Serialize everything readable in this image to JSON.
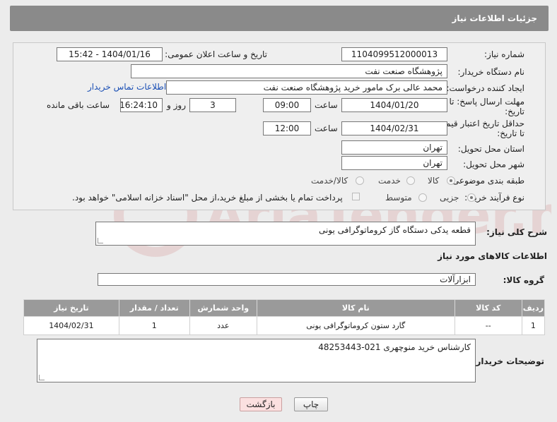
{
  "header": {
    "title": "جزئیات اطلاعات نیاز"
  },
  "form": {
    "need_number_label": "شماره نیاز:",
    "need_number": "1104099512000013",
    "announce_datetime_label": "تاریخ و ساعت اعلان عمومی:",
    "announce_datetime": "1404/01/16 - 15:42",
    "buyer_org_label": "نام دستگاه خریدار:",
    "buyer_org": "پژوهشگاه صنعت نفت",
    "requester_label": "ایجاد کننده درخواست:",
    "requester": "محمد عالی برک مامور خرید پژوهشگاه صنعت نفت",
    "buyer_contact_link": "اطلاعات تماس خریدار",
    "reply_deadline_label_1": "مهلت ارسال پاسخ: تا",
    "reply_deadline_label_2": "تاریخ:",
    "reply_date": "1404/01/20",
    "time_label": "ساعت",
    "reply_time": "09:00",
    "days_value": "3",
    "days_label": "روز و",
    "remaining_time": "16:24:10",
    "remaining_label": "ساعت باقی مانده",
    "price_validity_label_1": "حداقل تاریخ اعتبار قیمت:",
    "price_validity_label_2": "تا تاریخ:",
    "price_validity_date": "1404/02/31",
    "price_validity_time": "12:00",
    "delivery_province_label": "استان محل تحویل:",
    "delivery_province": "تهران",
    "delivery_city_label": "شهر محل تحویل:",
    "delivery_city": "تهران",
    "category_label": "طبقه بندی موضوعی:",
    "category_options": [
      "کالا",
      "خدمت",
      "کالا/خدمت"
    ],
    "category_selected": "کالا",
    "process_label": "نوع فرآیند خرید :",
    "process_options": [
      "جزیی",
      "متوسط"
    ],
    "process_selected": "جزیی",
    "payment_note": "پرداخت تمام یا بخشی از مبلغ خرید،از محل \"اسناد خزانه اسلامی\" خواهد بود."
  },
  "description": {
    "label": "شرح کلی نیاز:",
    "text": "قطعه یدکی دستگاه گاز کروماتوگرافی یونی"
  },
  "goods": {
    "section_title": "اطلاعات کالاهای مورد نیاز",
    "group_label": "گروه کالا:",
    "group_value": "ابزارآلات",
    "columns": [
      "ردیف",
      "کد کالا",
      "نام کالا",
      "واحد شمارش",
      "تعداد / مقدار",
      "تاریخ نیاز"
    ],
    "rows": [
      [
        "1",
        "--",
        "گارد ستون کروماتوگرافی یونی",
        "عدد",
        "1",
        "1404/02/31"
      ]
    ]
  },
  "buyer_notes": {
    "label": "توضیحات خریدار:",
    "text": "کارشناس خرید منوچهری 021-48253443"
  },
  "buttons": {
    "print": "چاپ",
    "back": "بازگشت"
  },
  "watermark_text": "AriaTender.net"
}
